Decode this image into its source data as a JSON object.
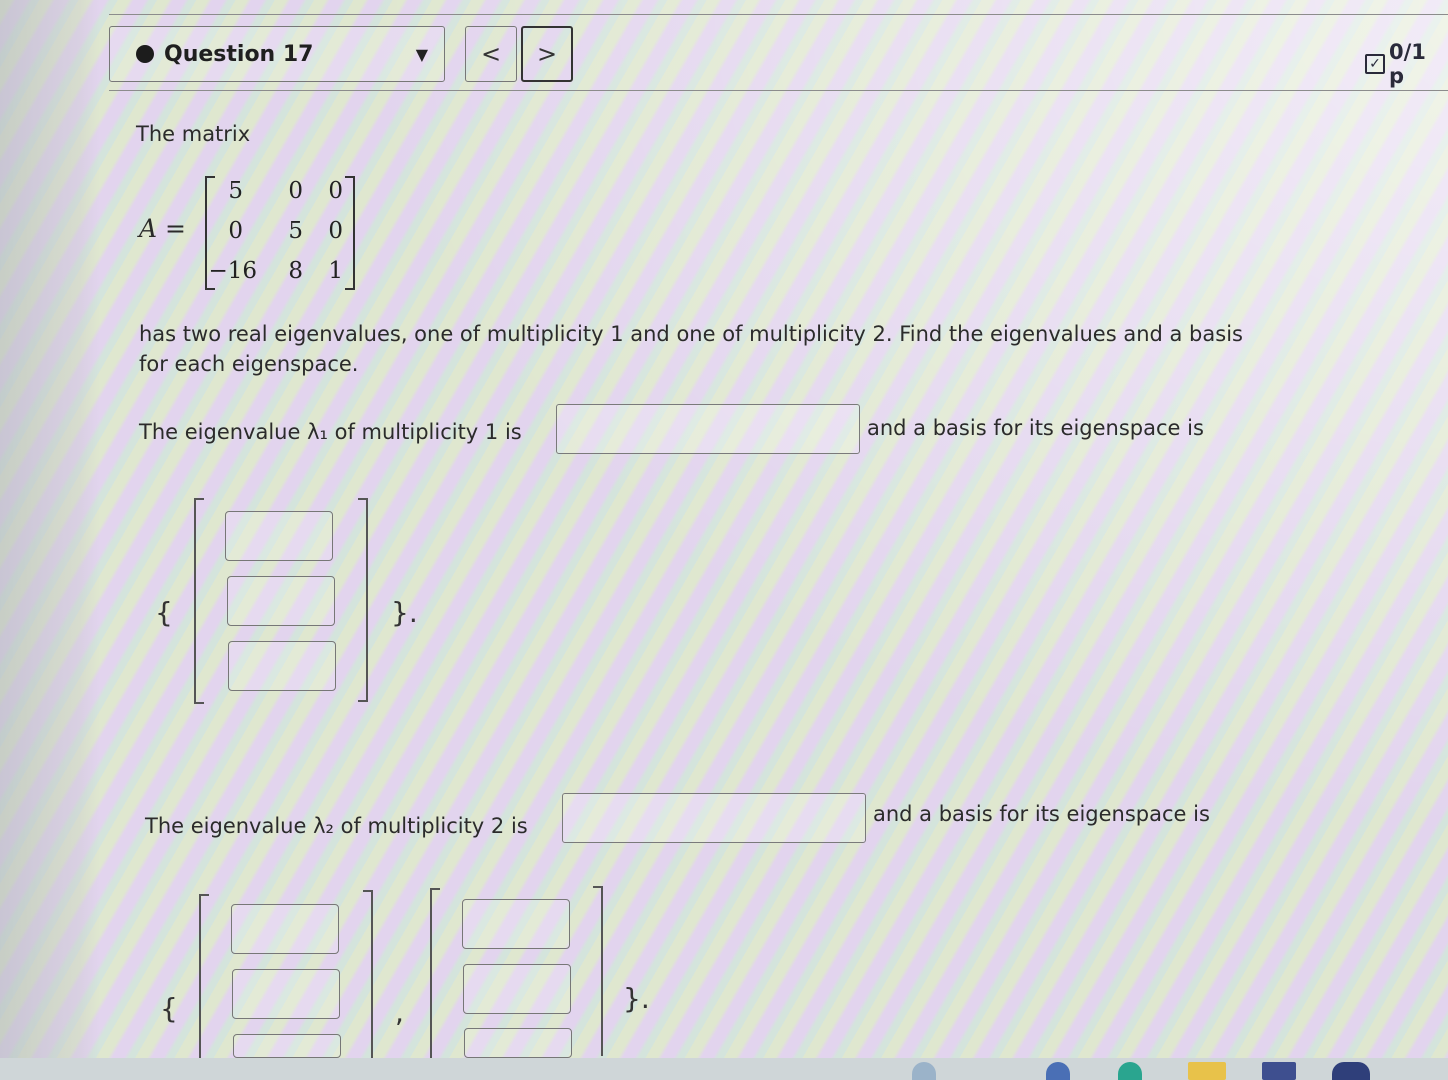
{
  "header": {
    "question_label": "Question 17",
    "prev_label": "<",
    "next_label": ">",
    "score": "0/1 p"
  },
  "problem": {
    "intro": "The matrix",
    "matrix_name": "A =",
    "matrix": [
      [
        "5",
        "0",
        "0"
      ],
      [
        "0",
        "5",
        "0"
      ],
      [
        "−16",
        "8",
        "1"
      ]
    ],
    "statement_line1": "has two real eigenvalues, one of multiplicity 1 and one of multiplicity 2. Find the eigenvalues and a basis",
    "statement_line2": "for each eigenspace.",
    "eig1_prefix": "The eigenvalue λ₁ of multiplicity 1 is",
    "eig1_suffix": "and a basis for its eigenspace is",
    "eig2_prefix": "The eigenvalue λ₂ of multiplicity 2 is",
    "eig2_suffix": "and a basis for its eigenspace is",
    "open_brace": "{",
    "close_brace": "}.",
    "comma": ","
  }
}
